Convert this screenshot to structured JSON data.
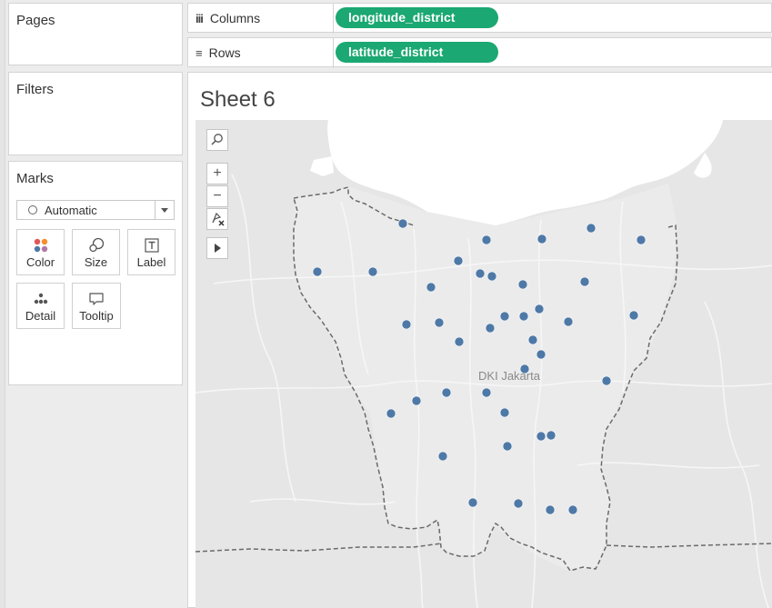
{
  "left_panel": {
    "pages_title": "Pages",
    "filters_title": "Filters",
    "marks_title": "Marks",
    "mark_type": "Automatic",
    "mark_buttons": [
      {
        "label": "Color",
        "icon": "color-dots-icon"
      },
      {
        "label": "Size",
        "icon": "size-circles-icon"
      },
      {
        "label": "Label",
        "icon": "label-t-icon"
      },
      {
        "label": "Detail",
        "icon": "detail-dots-icon"
      },
      {
        "label": "Tooltip",
        "icon": "tooltip-bubble-icon"
      }
    ]
  },
  "shelves": {
    "columns_label": "Columns",
    "columns_pill": "longitude_district",
    "rows_label": "Rows",
    "rows_pill": "latitude_district"
  },
  "sheet": {
    "title": "Sheet 6"
  },
  "map": {
    "region_label": "DKI Jakarta",
    "point_color": "#4e79a7",
    "tools": [
      "search-icon",
      "zoom-in-icon",
      "zoom-out-icon",
      "pin-reset-icon",
      "play-icon"
    ]
  },
  "colors": {
    "pill": "#1ba872",
    "map_land": "#e6e6e6",
    "map_sea": "#ffffff"
  }
}
